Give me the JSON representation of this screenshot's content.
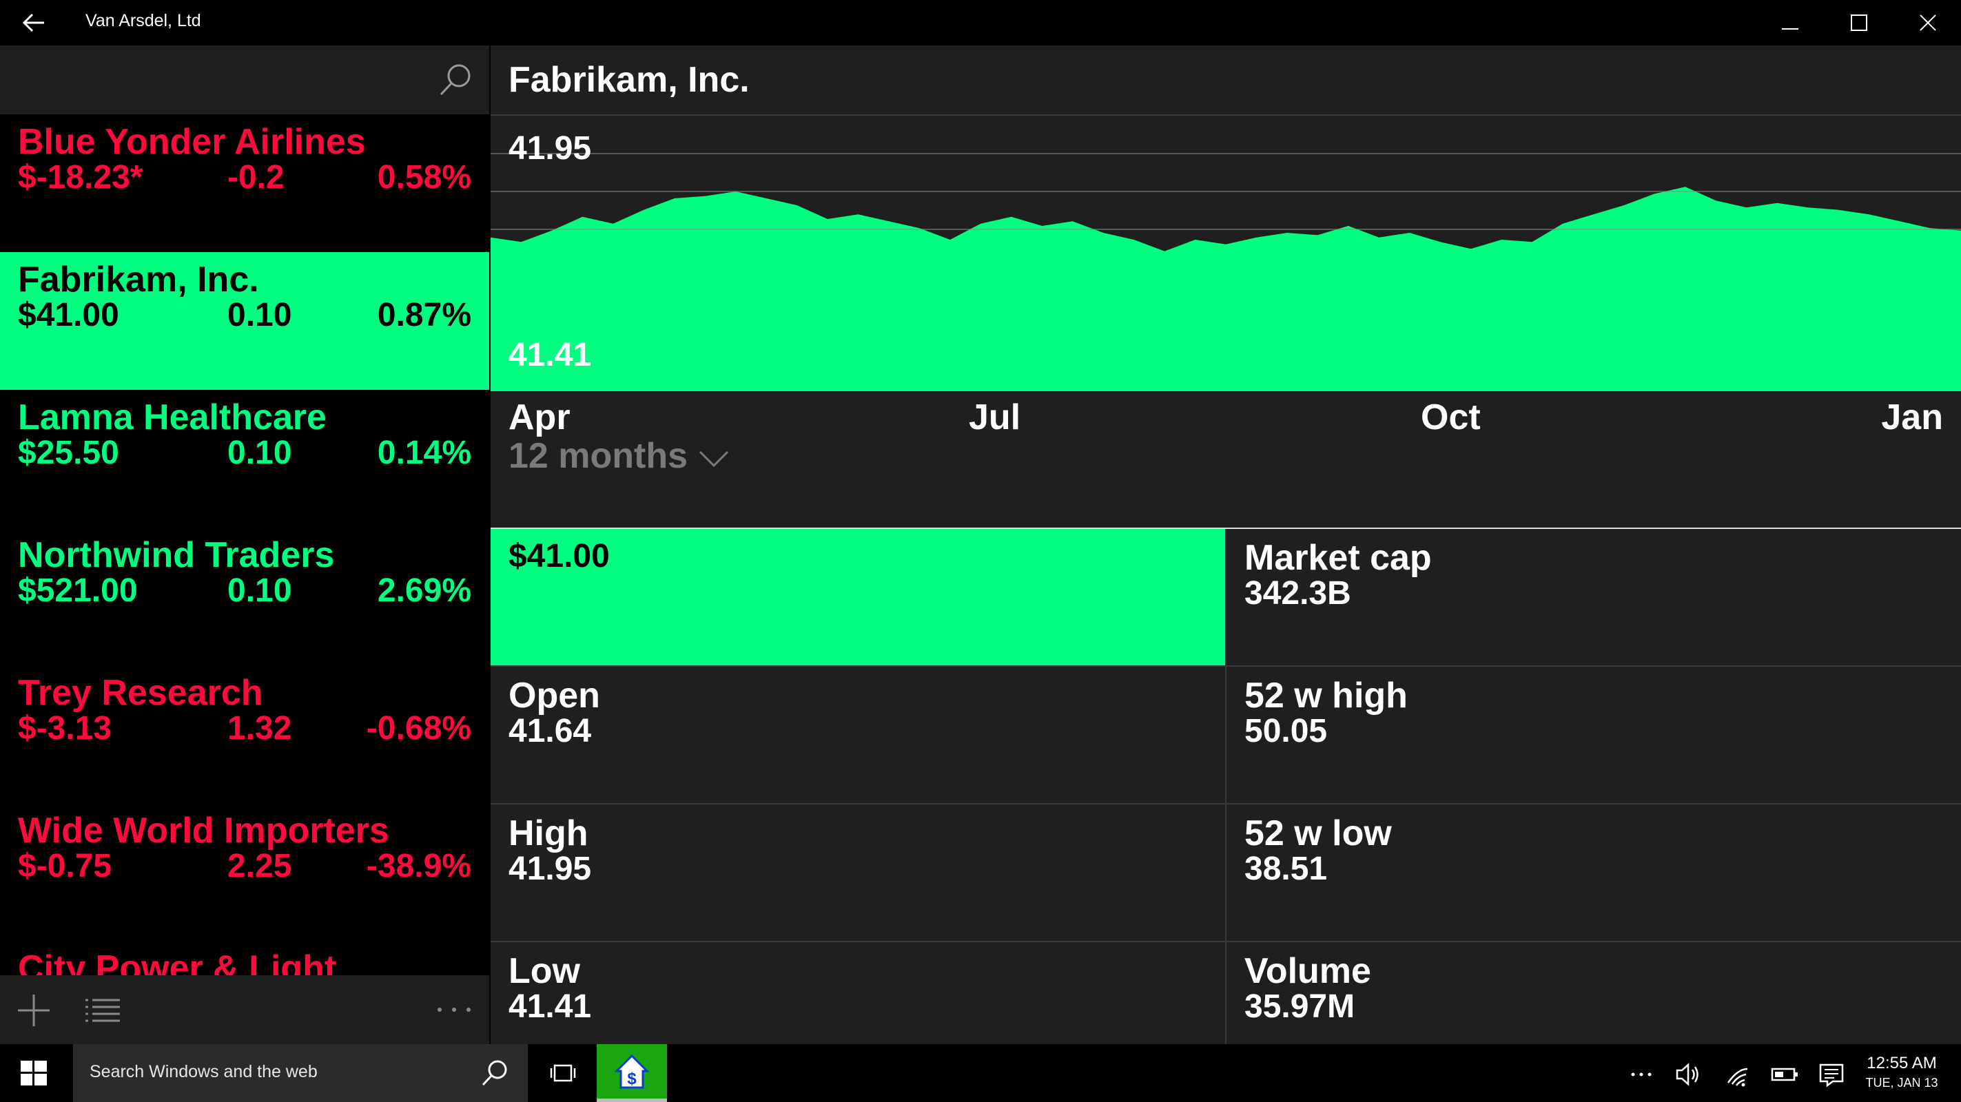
{
  "window": {
    "title": "Van Arsdel, Ltd"
  },
  "sidebar": {
    "stocks": [
      {
        "name": "Blue Yonder Airlines",
        "price": "$-18.23*",
        "change": "-0.2",
        "percent": "0.58%",
        "trend": "down"
      },
      {
        "name": "Fabrikam, Inc.",
        "price": "$41.00",
        "change": "0.10",
        "percent": "0.87%",
        "trend": "up",
        "selected": true
      },
      {
        "name": "Lamna Healthcare",
        "price": "$25.50",
        "change": "0.10",
        "percent": "0.14%",
        "trend": "up"
      },
      {
        "name": "Northwind Traders",
        "price": "$521.00",
        "change": "0.10",
        "percent": "2.69%",
        "trend": "up"
      },
      {
        "name": "Trey Research",
        "price": "$-3.13",
        "change": "1.32",
        "percent": "-0.68%",
        "trend": "down"
      },
      {
        "name": "Wide World Importers",
        "price": "$-0.75",
        "change": "2.25",
        "percent": "-38.9%",
        "trend": "down"
      },
      {
        "name": "City Power & Light",
        "price": "",
        "change": "",
        "percent": "",
        "trend": "down"
      }
    ]
  },
  "detail": {
    "company": "Fabrikam, Inc.",
    "chart_high_label": "41.95",
    "chart_low_label": "41.41",
    "axis_labels": [
      "Apr",
      "Jul",
      "Oct",
      "Jan"
    ],
    "range": "12 months",
    "current_price": "$41.00",
    "stats": {
      "market_cap_label": "Market cap",
      "market_cap": "342.3B",
      "open_label": "Open",
      "open": "41.64",
      "week52_high_label": "52 w high",
      "week52_high": "50.05",
      "high_label": "High",
      "high": "41.95",
      "week52_low_label": "52 w low",
      "week52_low": "38.51",
      "low_label": "Low",
      "low": "41.41",
      "volume_label": "Volume",
      "volume": "35.97M"
    }
  },
  "chart_data": {
    "type": "area",
    "title": "",
    "x_tick_labels": [
      "Apr",
      "Jul",
      "Oct",
      "Jan"
    ],
    "y_labels": [
      "41.95",
      "41.41"
    ],
    "ylim": [
      41.41,
      41.95
    ],
    "grid": true,
    "values": [
      41.72,
      41.7,
      41.75,
      41.81,
      41.78,
      41.84,
      41.89,
      41.9,
      41.92,
      41.89,
      41.86,
      41.8,
      41.82,
      41.79,
      41.76,
      41.71,
      41.78,
      41.81,
      41.77,
      41.79,
      41.74,
      41.71,
      41.66,
      41.71,
      41.69,
      41.72,
      41.74,
      41.73,
      41.77,
      41.72,
      41.74,
      41.7,
      41.67,
      41.71,
      41.7,
      41.78,
      41.82,
      41.86,
      41.91,
      41.94,
      41.88,
      41.85,
      41.87,
      41.85,
      41.84,
      41.82,
      41.79,
      41.76,
      41.75
    ],
    "color": "#00ff80"
  },
  "taskbar": {
    "search_placeholder": "Search Windows and the web",
    "time": "12:55 AM",
    "date": "TUE, JAN 13"
  },
  "colors": {
    "positive": "#00ff80",
    "negative": "#ff0a3c",
    "panel": "#1f1f1f"
  }
}
